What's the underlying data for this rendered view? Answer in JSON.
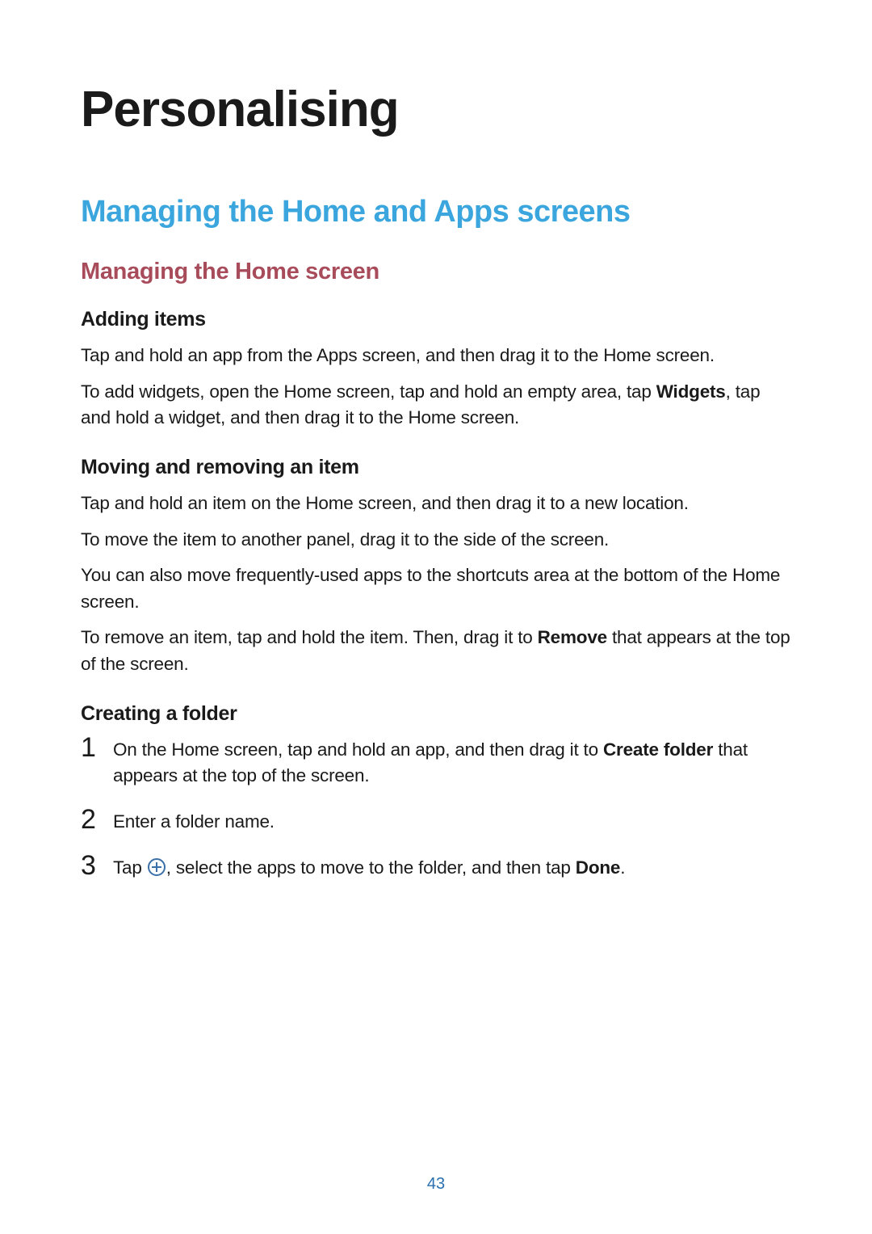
{
  "h1": "Personalising",
  "h2": "Managing the Home and Apps screens",
  "h3": "Managing the Home screen",
  "sec_adding": {
    "title": "Adding items",
    "p1": "Tap and hold an app from the Apps screen, and then drag it to the Home screen.",
    "p2_pre": "To add widgets, open the Home screen, tap and hold an empty area, tap ",
    "p2_bold": "Widgets",
    "p2_post": ", tap and hold a widget, and then drag it to the Home screen."
  },
  "sec_moving": {
    "title": "Moving and removing an item",
    "p1": "Tap and hold an item on the Home screen, and then drag it to a new location.",
    "p2": "To move the item to another panel, drag it to the side of the screen.",
    "p3": "You can also move frequently-used apps to the shortcuts area at the bottom of the Home screen.",
    "p4_pre": "To remove an item, tap and hold the item. Then, drag it to ",
    "p4_bold": "Remove",
    "p4_post": " that appears at the top of the screen."
  },
  "sec_folder": {
    "title": "Creating a folder",
    "steps": {
      "n1": "1",
      "s1_pre": "On the Home screen, tap and hold an app, and then drag it to ",
      "s1_bold": "Create folder",
      "s1_post": " that appears at the top of the screen.",
      "n2": "2",
      "s2": "Enter a folder name.",
      "n3": "3",
      "s3_pre": "Tap ",
      "s3_mid": ", select the apps to move to the folder, and then tap ",
      "s3_bold": "Done",
      "s3_post": "."
    }
  },
  "page_number": "43"
}
